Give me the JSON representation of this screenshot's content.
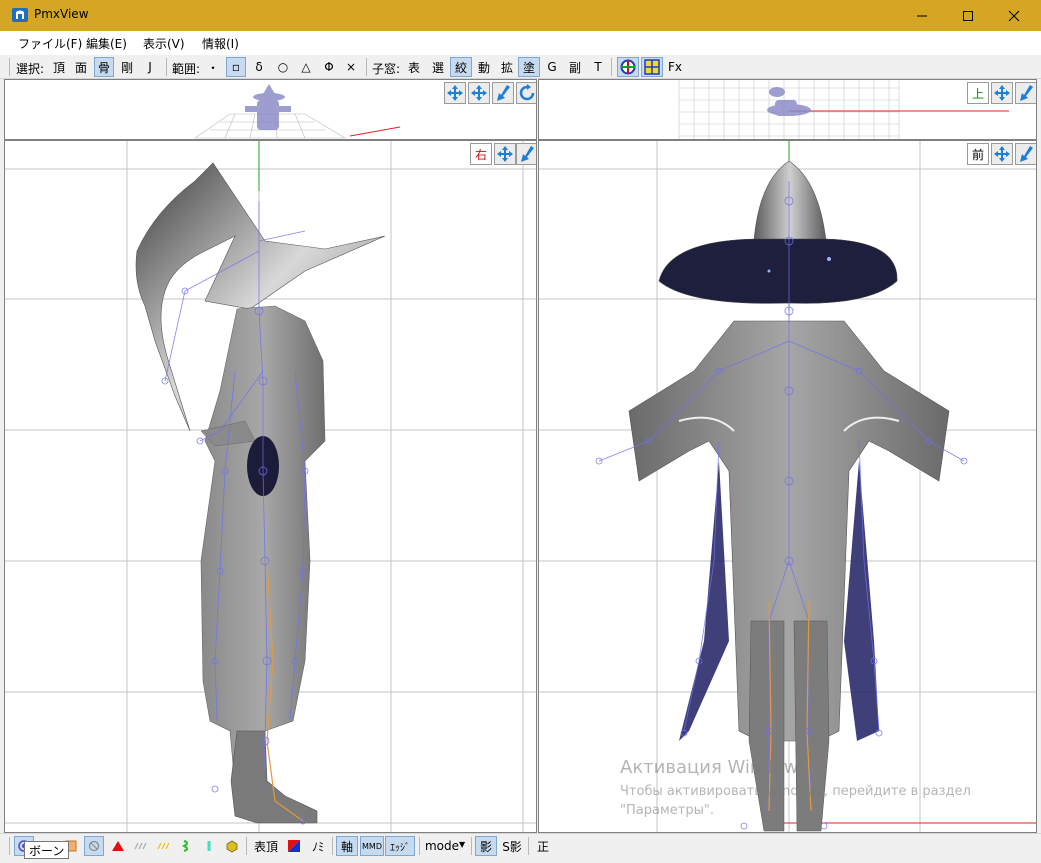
{
  "window": {
    "title": "PmxView"
  },
  "menu": [
    "ファイル(F)",
    "編集(E)",
    "表示(V)",
    "情報(I)"
  ],
  "toolbar": {
    "select_label": "選択:",
    "select_items": [
      "頂",
      "面",
      "骨",
      "剛",
      "J"
    ],
    "select_active": "骨",
    "range_label": "範囲:",
    "range_items": [
      "・",
      "▫",
      "δ",
      "○",
      "△",
      "Φ",
      "×"
    ],
    "child_label": "子窓:",
    "child_items": [
      "表",
      "選",
      "絞",
      "動",
      "拡",
      "塗",
      "G",
      "副",
      "T"
    ],
    "fx_label": "Fx"
  },
  "views": {
    "top_view_label": "上",
    "right_view_label": "右",
    "front_view_label": "前"
  },
  "statusbar": {
    "items": [
      "表頂",
      "ﾉﾐ",
      "軸",
      "MMD",
      "ｴｯｼﾞ",
      "mode",
      "影",
      "S影",
      "正"
    ]
  },
  "tooltip": "ボーン",
  "watermark": {
    "title": "Активация Windows",
    "subtitle": "Чтобы активировать Windows, перейдите в раздел \"Параметры\"."
  },
  "colors": {
    "titlebar": "#d4a624",
    "selected_button": "#c6dbf0",
    "grid": "#c0c0c0",
    "bone": "#7070ee",
    "leg_bone": "#e09a40"
  }
}
